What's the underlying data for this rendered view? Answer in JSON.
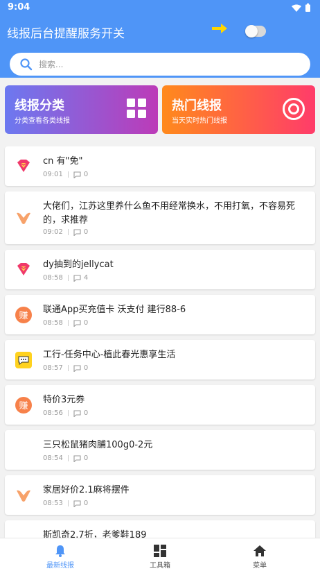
{
  "status": {
    "time": "9:04"
  },
  "header": {
    "title": "线报后台提醒服务开关",
    "toggle_on": false
  },
  "search": {
    "placeholder": "搜索..."
  },
  "categories": [
    {
      "title": "线报分类",
      "subtitle": "分类查看各类线报",
      "icon": "grid-icon"
    },
    {
      "title": "热门线报",
      "subtitle": "当天实时热门线报",
      "icon": "target-icon"
    }
  ],
  "posts": [
    {
      "title": "cn 有\"免\"",
      "time": "09:01",
      "comments": "0",
      "avatar": "diamond-logo-icon"
    },
    {
      "title": "大佬们，江苏这里养什么鱼不用经常换水，不用打氧，不容易死的，求推荐",
      "time": "09:02",
      "comments": "0",
      "avatar": "v-logo-icon"
    },
    {
      "title": "dy抽到的jellycat",
      "time": "08:58",
      "comments": "4",
      "avatar": "diamond-logo-icon"
    },
    {
      "title": "联通App买充值卡 沃支付 建行88-6",
      "time": "08:58",
      "comments": "0",
      "avatar": "zhuan-badge-icon"
    },
    {
      "title": "工行-任务中心-植此春光惠享生活",
      "time": "08:57",
      "comments": "0",
      "avatar": "chat-bubble-icon"
    },
    {
      "title": "特价3元券",
      "time": "08:56",
      "comments": "0",
      "avatar": "zhuan-badge-icon"
    },
    {
      "title": "三只松鼠猪肉脯100g0-2元",
      "time": "08:54",
      "comments": "0",
      "avatar": ""
    },
    {
      "title": "家居好价2.1麻将摆件",
      "time": "08:53",
      "comments": "0",
      "avatar": "v-logo-icon"
    },
    {
      "title": "斯凯奇2.7折，老爹鞋189",
      "time": "",
      "comments": "",
      "avatar": ""
    }
  ],
  "badge_char": "赚",
  "tabs": [
    {
      "label": "最新线报",
      "icon": "bell-icon",
      "active": true
    },
    {
      "label": "工具箱",
      "icon": "dashboard-icon",
      "active": false
    },
    {
      "label": "菜单",
      "icon": "home-icon",
      "active": false
    }
  ],
  "colors": {
    "primary": "#4f95f7",
    "arrow": "#ffd600",
    "badge": "#f7814a"
  }
}
